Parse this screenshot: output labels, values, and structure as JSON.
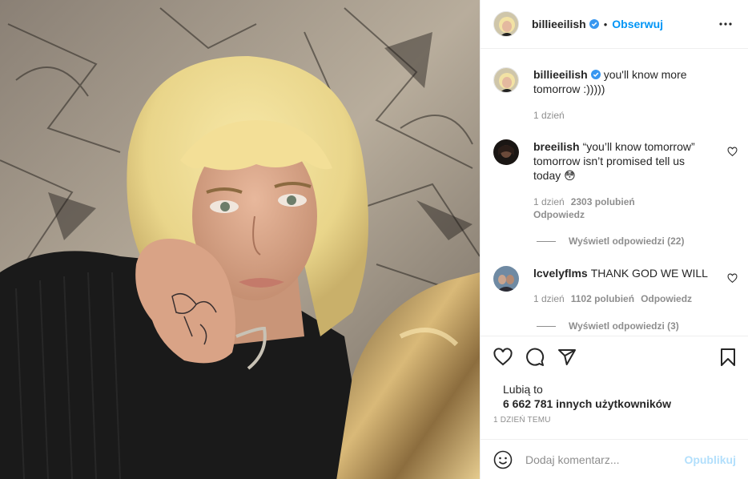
{
  "post": {
    "author": {
      "username": "billieeilish",
      "verified": true,
      "follow_label": "Obserwuj"
    },
    "caption": {
      "text": "you'll know more tomorrow :)))))",
      "time": "1 dzień"
    },
    "comments": [
      {
        "username": "breeilish",
        "text": "“you’ll know tomorrow” tomorrow isn’t promised tell us today 😳",
        "time": "1 dzień",
        "likes": "2303 polubień",
        "reply_label": "Odpowiedz",
        "view_replies": "Wyświetl odpowiedzi (22)"
      },
      {
        "username": "lcvelyflms",
        "text": "THANK GOD WE WILL",
        "time": "1 dzień",
        "likes": "1102 polubień",
        "reply_label": "Odpowiedz",
        "view_replies": "Wyświetl odpowiedzi (3)"
      }
    ],
    "likes": {
      "label": "Lubią to",
      "count_text": "6 662 781 innych użytkowników"
    },
    "timestamp": "1 dzień temu",
    "add_comment": {
      "placeholder": "Dodaj komentarz...",
      "publish_label": "Opublikuj"
    }
  },
  "icons": [
    "verified-icon",
    "more-options-icon",
    "heart-icon",
    "comment-icon",
    "share-icon",
    "bookmark-icon",
    "emoji-icon"
  ],
  "colors": {
    "accent": "#0095f6",
    "verified": "#3897f0",
    "publish_disabled": "#b2dffc",
    "muted": "#8e8e8e",
    "text": "#262626"
  }
}
